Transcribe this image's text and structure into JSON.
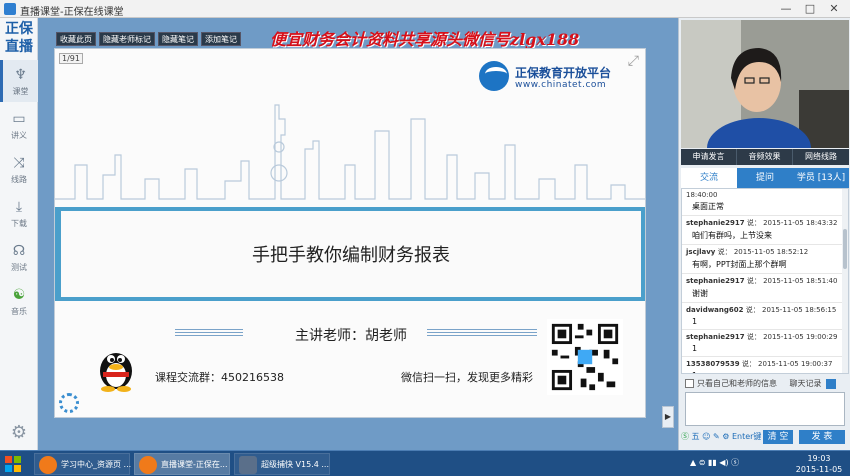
{
  "window": {
    "title": "直播课堂-正保在线课堂"
  },
  "sidebar": {
    "brand_line1": "正保",
    "brand_line2": "直播",
    "items": [
      {
        "label": "课堂",
        "icon": "microscope-icon"
      },
      {
        "label": "讲义",
        "icon": "chart-icon"
      },
      {
        "label": "线路",
        "icon": "shuffle-icon"
      },
      {
        "label": "下载",
        "icon": "download-icon"
      },
      {
        "label": "测试",
        "icon": "headset-icon"
      },
      {
        "label": "音乐",
        "icon": "music-icon"
      }
    ]
  },
  "toolbar": {
    "buttons": [
      "收藏此页",
      "隐藏老师标记",
      "隐藏笔记",
      "添加笔记"
    ]
  },
  "ad_banner": "便宜财务会计资料共享源头微信号zlgx188",
  "slide": {
    "page_number": "1/91",
    "logo_name": "正保教育开放平台",
    "logo_url": "www.chinatet.com",
    "title": "手把手教你编制财务报表",
    "teacher": "主讲老师：胡老师",
    "group_label": "课程交流群：",
    "group_number": "450216538",
    "wechat_text": "微信扫一扫，发现更多精彩"
  },
  "media_bar": [
    "申请发言",
    "音频效果",
    "网络线路"
  ],
  "tabs": [
    "交流",
    "提问",
    "学员 [13人]"
  ],
  "chat": {
    "messages": [
      {
        "user": "",
        "said": "",
        "time": "18:40:00",
        "text": "桌面正常"
      },
      {
        "user": "stephanie2917",
        "said": "说：",
        "time": "2015-11-05 18:43:32",
        "text": "咱们有群吗，上节没来"
      },
      {
        "user": "jscjlavy",
        "said": "说：",
        "time": "2015-11-05 18:52:12",
        "text": "有啊，PPT封面上那个群啊"
      },
      {
        "user": "stephanie2917",
        "said": "说：",
        "time": "2015-11-05 18:51:40",
        "text": "谢谢"
      },
      {
        "user": "davidwang602",
        "said": "说：",
        "time": "2015-11-05 18:56:15",
        "text": "1"
      },
      {
        "user": "stephanie2917",
        "said": "说：",
        "time": "2015-11-05 19:00:29",
        "text": "1"
      },
      {
        "user": "13538079539",
        "said": "说：",
        "time": "2015-11-05 19:00:37",
        "text": "1"
      }
    ],
    "only_teacher_label": "只看自己和老师的信息",
    "chat_record_label": "聊天记录",
    "emoji_label": "五",
    "enter_label": "Enter键",
    "clear_label": "清 空",
    "send_label": "发 表"
  },
  "taskbar": {
    "tasks": [
      "学习中心_资源页 ...",
      "直播课堂-正保在...",
      "超级捕快 V15.4 ..."
    ],
    "time": "19:03",
    "date": "2015-11-05"
  }
}
